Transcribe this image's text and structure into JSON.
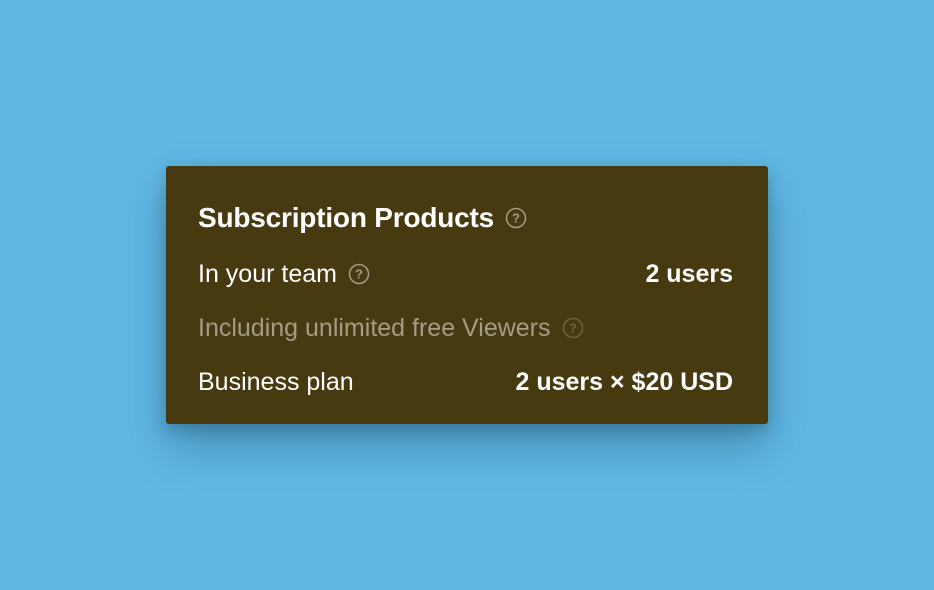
{
  "card": {
    "title": "Subscription Products",
    "title_help_icon": "question-circle-icon",
    "rows": [
      {
        "label": "In your team",
        "value": "2 users",
        "help_icon": "question-circle-icon"
      },
      {
        "label": "Including unlimited free Viewers",
        "value": "",
        "help_icon": "question-circle-icon"
      },
      {
        "label": "Business plan",
        "value": "2 users × $20 USD"
      }
    ]
  },
  "colors": {
    "page_background": "#60b8e4",
    "card_background": "#473a11",
    "text_primary": "#ffffff",
    "text_muted": "#a39c86"
  }
}
